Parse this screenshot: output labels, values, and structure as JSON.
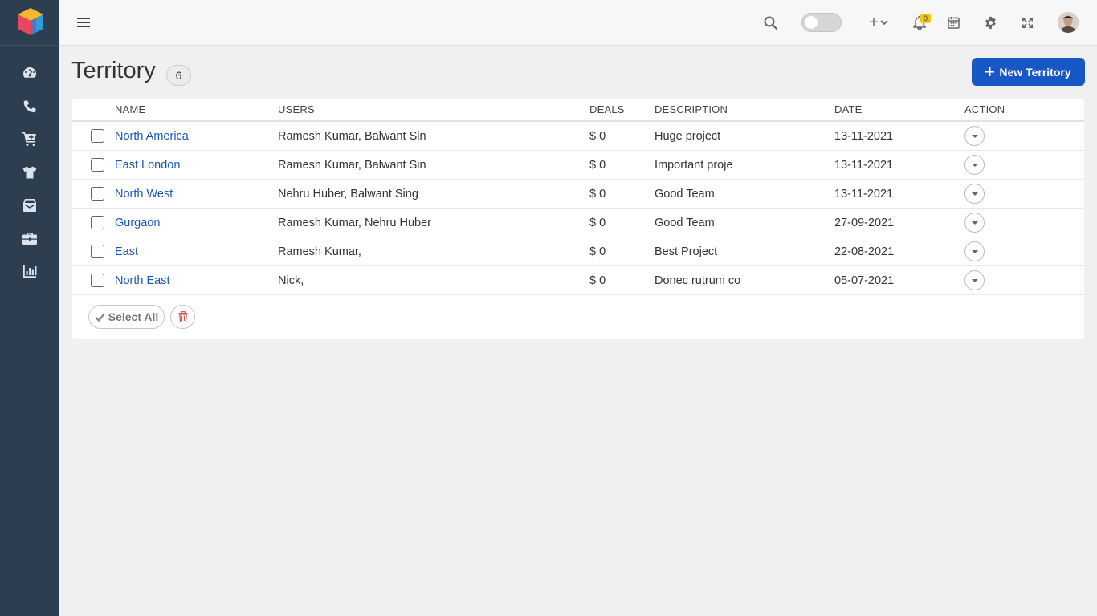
{
  "sidebar": {
    "items": [
      {
        "icon": "dashboard-icon"
      },
      {
        "icon": "phone-icon"
      },
      {
        "icon": "cart-icon"
      },
      {
        "icon": "tshirt-icon"
      },
      {
        "icon": "inbox-icon"
      },
      {
        "icon": "briefcase-icon"
      },
      {
        "icon": "bar-chart-icon"
      }
    ]
  },
  "topbar": {
    "notifications_count": "0",
    "add_label": "+"
  },
  "page": {
    "title": "Territory",
    "count": "6",
    "new_button_label": "New Territory"
  },
  "table": {
    "columns": [
      "NAME",
      "USERS",
      "DEALS",
      "DESCRIPTION",
      "DATE",
      "ACTION"
    ],
    "rows": [
      {
        "name": "North America",
        "users": "Ramesh Kumar, Balwant Sin",
        "deals": "$ 0",
        "description": "Huge project",
        "date": "13-11-2021"
      },
      {
        "name": "East London",
        "users": "Ramesh Kumar, Balwant Sin",
        "deals": "$ 0",
        "description": "Important proje",
        "date": "13-11-2021"
      },
      {
        "name": "North West",
        "users": "Nehru Huber, Balwant Sing",
        "deals": "$ 0",
        "description": "Good Team",
        "date": "13-11-2021"
      },
      {
        "name": "Gurgaon",
        "users": "Ramesh Kumar, Nehru Huber",
        "deals": "$ 0",
        "description": "Good Team",
        "date": "27-09-2021"
      },
      {
        "name": "East",
        "users": "Ramesh Kumar,",
        "deals": "$ 0",
        "description": "Best Project",
        "date": "22-08-2021"
      },
      {
        "name": "North East",
        "users": "Nick,",
        "deals": "$ 0",
        "description": "Donec rutrum co",
        "date": "05-07-2021"
      }
    ]
  },
  "footer": {
    "select_all_label": "Select All"
  },
  "colors": {
    "sidebar_bg": "#2c3e50",
    "primary": "#1758c4",
    "link": "#1a56b8",
    "badge": "#f1c40f",
    "delete": "#d9534f"
  }
}
